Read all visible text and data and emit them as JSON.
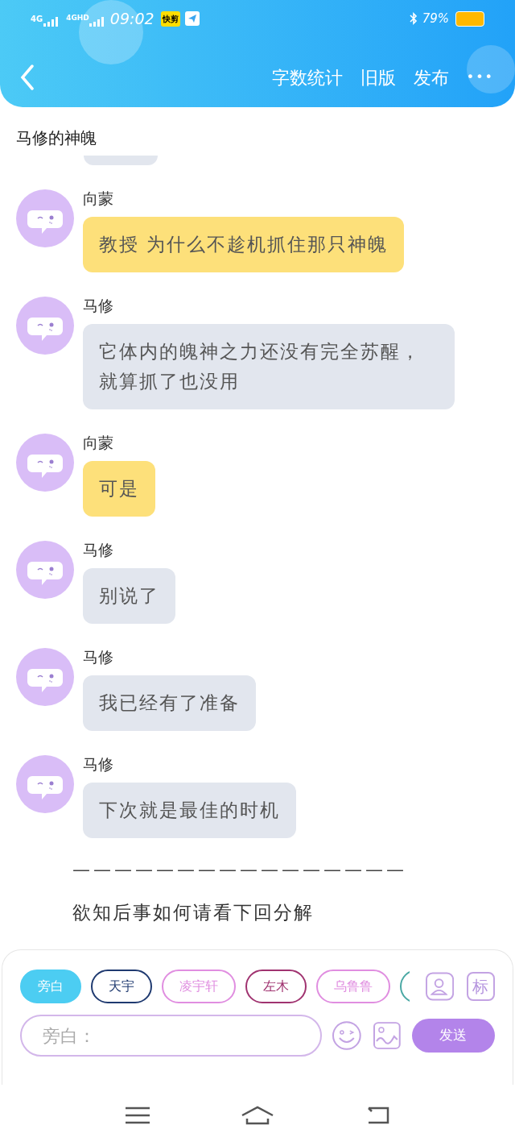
{
  "status_bar": {
    "network_1": "4G",
    "network_2": "4GHD",
    "time": "09:02",
    "app_badge": "快剪",
    "battery": "79%"
  },
  "header": {
    "actions": [
      "字数统计",
      "旧版",
      "发布"
    ],
    "more": "•••"
  },
  "title": "马修的神魄",
  "partial_bubble": {
    "color": "#e2e6ee"
  },
  "messages": [
    {
      "name": "向蒙",
      "text": "教授 为什么不趁机抓住那只神魄",
      "color": "#fde07a"
    },
    {
      "name": "马修",
      "text": "它体内的魄神之力还没有完全苏醒，就算抓了也没用",
      "color": "#e2e6ee"
    },
    {
      "name": "向蒙",
      "text": "可是",
      "color": "#fde07a"
    },
    {
      "name": "马修",
      "text": "别说了",
      "color": "#e2e6ee"
    },
    {
      "name": "马修",
      "text": "我已经有了准备",
      "color": "#e2e6ee"
    },
    {
      "name": "马修",
      "text": "下次就是最佳的时机",
      "color": "#e2e6ee"
    }
  ],
  "separator": "————————————————",
  "ending": "欲知后事如何请看下回分解",
  "composer": {
    "roles": [
      {
        "label": "旁白",
        "color": "#4ccdf2",
        "selected": true
      },
      {
        "label": "天宇",
        "color": "#1f3a70",
        "selected": false
      },
      {
        "label": "凌宇轩",
        "color": "#e08ee0",
        "selected": false
      },
      {
        "label": "左木",
        "color": "#a03370",
        "selected": false
      },
      {
        "label": "乌鲁鲁",
        "color": "#e08ee0",
        "selected": false
      },
      {
        "color": "#4aa8a4",
        "selected": false
      }
    ],
    "tag_button": "标",
    "placeholder": "旁白：",
    "send": "发送"
  }
}
